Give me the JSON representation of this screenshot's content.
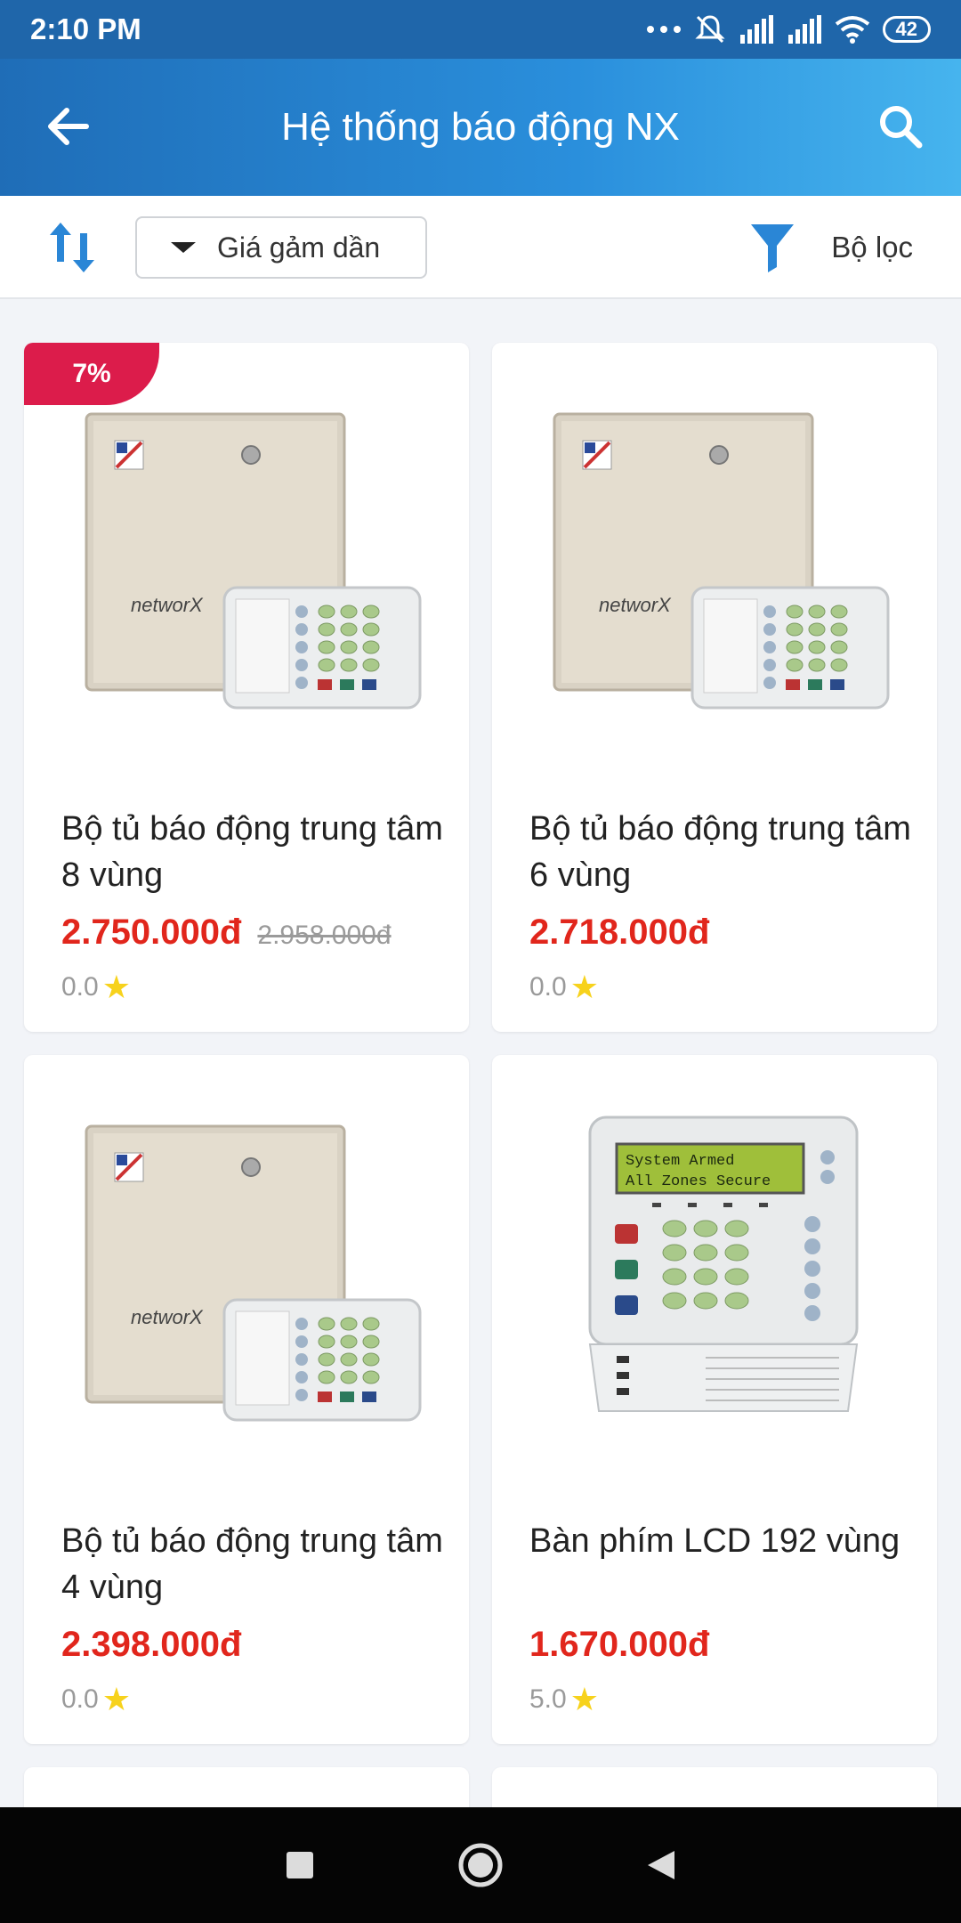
{
  "status_bar": {
    "time": "2:10 PM",
    "battery": "42",
    "icons": [
      "dots-icon",
      "mute-icon",
      "signal-icon",
      "signal-icon",
      "wifi-icon",
      "battery-icon"
    ]
  },
  "header": {
    "title": "Hệ thống báo động NX",
    "back_icon": "arrow-left-icon",
    "search_icon": "search-icon"
  },
  "toolbar": {
    "sort_icon": "sort-arrows-icon",
    "sort_value": "Giá gảm dần",
    "filter_label": "Bộ lọc",
    "filter_icon": "funnel-icon"
  },
  "products": [
    {
      "name": "Bộ tủ báo động trung tâm 8 vùng",
      "price": "2.750.000đ",
      "old_price": "2.958.000đ",
      "rating": "0.0",
      "badge": "7%",
      "image": "networx-panel-keypad"
    },
    {
      "name": "Bộ tủ báo động trung tâm 6 vùng",
      "price": "2.718.000đ",
      "old_price": "",
      "rating": "0.0",
      "badge": "",
      "image": "networx-panel-keypad"
    },
    {
      "name": "Bộ tủ báo động trung tâm 4 vùng",
      "price": "2.398.000đ",
      "old_price": "",
      "rating": "0.0",
      "badge": "",
      "image": "networx-panel-keypad"
    },
    {
      "name": "Bàn phím LCD 192 vùng",
      "price": "1.670.000đ",
      "old_price": "",
      "rating": "5.0",
      "badge": "",
      "image": "lcd-keypad",
      "lcd_text": [
        "System Armed",
        "All Zones Secure"
      ]
    }
  ],
  "colors": {
    "header_start": "#1f6db7",
    "header_end": "#46b4ee",
    "price": "#e1261c",
    "badge": "#dc1c4b",
    "sort_icon": "#2a86d6",
    "star": "#f7d21c"
  },
  "nav_bar": {
    "icons": [
      "recents-square-icon",
      "home-circle-icon",
      "back-triangle-icon"
    ]
  }
}
